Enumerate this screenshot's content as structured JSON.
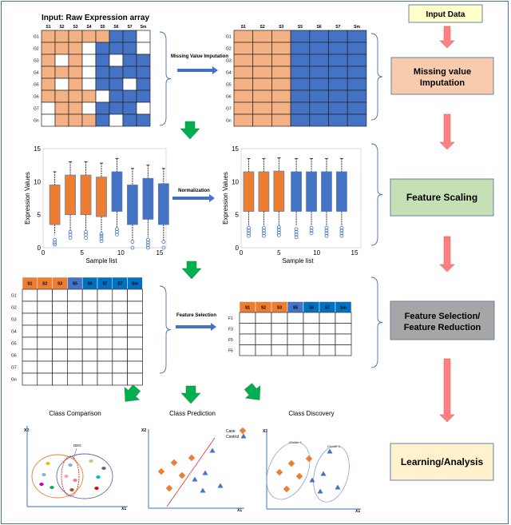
{
  "raw_matrix": {
    "title": "Input: Raw Expression array",
    "columns": [
      "S1",
      "S2",
      "S3",
      "S4",
      "S5",
      "S6",
      "S7",
      "Sm"
    ],
    "rows": [
      "G1",
      "G2",
      "G3",
      "G4",
      "G5",
      "G6",
      "G7",
      "Gn"
    ],
    "cells": [
      "ooooobbwb",
      "ooowbbbw",
      "owowbwbb",
      "ooowbbbb",
      "owowbbwb",
      "oooowbbb",
      "woowbbbw",
      "wooobwbb"
    ]
  },
  "imputation_arrow_label": "Missing Value Imputation",
  "imputed_matrix": {
    "columns": [
      "S1",
      "S2",
      "S3",
      "S5",
      "S6",
      "S7",
      "Sm"
    ],
    "rows": [
      "G1",
      "G2",
      "G3",
      "G4",
      "G5",
      "G6",
      "G7",
      "Gn"
    ],
    "orange_columns": 3
  },
  "normalization_arrow_label": "Normalization",
  "chart_data": [
    {
      "type": "box",
      "xlabel": "Sample list",
      "ylabel": "Expression Values",
      "xlim": [
        0,
        15
      ],
      "ylim": [
        0,
        15
      ],
      "xticks": [
        "0",
        "5",
        "10",
        "15"
      ],
      "yticks": [
        "0",
        "5",
        "10",
        "15"
      ],
      "boxes": [
        {
          "x": 1.5,
          "q1": 3.5,
          "q3": 9.5,
          "hi": 11.5,
          "lo": 2,
          "outliers": [
            0.5,
            0.8,
            1.2
          ],
          "group": "case"
        },
        {
          "x": 3.5,
          "q1": 5,
          "q3": 11,
          "hi": 13,
          "lo": 2.5,
          "outliers": [
            1.5,
            2,
            2.4
          ],
          "group": "case"
        },
        {
          "x": 5.5,
          "q1": 5,
          "q3": 11,
          "hi": 13,
          "lo": 2.5,
          "outliers": [
            1.5,
            2,
            2.4
          ],
          "group": "case"
        },
        {
          "x": 7.5,
          "q1": 4.7,
          "q3": 10.7,
          "hi": 12.8,
          "lo": 2.3,
          "outliers": [
            1,
            1.4,
            1.8,
            2.1
          ],
          "group": "case"
        },
        {
          "x": 9.5,
          "q1": 5.5,
          "q3": 11.5,
          "hi": 13.5,
          "lo": 3,
          "outliers": [
            2,
            2.4,
            2.8
          ],
          "group": "control"
        },
        {
          "x": 11.5,
          "q1": 3.5,
          "q3": 9.5,
          "hi": 12,
          "lo": 1.2,
          "outliers": [
            0,
            0.9
          ],
          "group": "control"
        },
        {
          "x": 13.5,
          "q1": 4.3,
          "q3": 10.5,
          "hi": 12.5,
          "lo": 1.6,
          "outliers": [
            0,
            0.4,
            0.8,
            1.2
          ],
          "group": "control"
        },
        {
          "x": 15.5,
          "q1": 3.5,
          "q3": 9.7,
          "hi": 12,
          "lo": 1.2,
          "outliers": [
            0,
            0.9
          ],
          "group": "control"
        }
      ]
    },
    {
      "type": "box",
      "xlabel": "Sample list",
      "ylabel": "Expression Values",
      "xlim": [
        0,
        15
      ],
      "ylim": [
        0,
        15
      ],
      "xticks": [
        "0",
        "5",
        "10",
        "15"
      ],
      "yticks": [
        "0",
        "5",
        "10",
        "15"
      ],
      "boxes": [
        {
          "x": 1,
          "q1": 5.5,
          "q3": 11.5,
          "hi": 13.5,
          "lo": 3.3,
          "outliers": [
            1.8,
            2.2,
            2.6,
            3
          ]
        },
        {
          "x": 3,
          "q1": 5.5,
          "q3": 11.5,
          "hi": 13.5,
          "lo": 3.3,
          "outliers": [
            1.8,
            2.2,
            2.6,
            3
          ]
        },
        {
          "x": 5,
          "q1": 5.5,
          "q3": 11.6,
          "hi": 13.6,
          "lo": 3.3,
          "outliers": [
            1.9,
            2.3,
            2.7,
            3.1
          ]
        },
        {
          "x": 7.3,
          "q1": 5.5,
          "q3": 11.5,
          "hi": 13.5,
          "lo": 3.3,
          "outliers": [
            1.6,
            2,
            2.4,
            2.8
          ]
        },
        {
          "x": 9.3,
          "q1": 5.5,
          "q3": 11.5,
          "hi": 13.5,
          "lo": 3.3,
          "outliers": [
            2.2,
            2.6,
            3
          ]
        },
        {
          "x": 11.3,
          "q1": 5.5,
          "q3": 11.5,
          "hi": 13.5,
          "lo": 3.3,
          "outliers": [
            1.8,
            2.2,
            2.6,
            3
          ]
        },
        {
          "x": 13.3,
          "q1": 5.5,
          "q3": 11.5,
          "hi": 13.5,
          "lo": 3.3,
          "outliers": [
            1.8,
            2.2,
            2.6,
            3
          ]
        }
      ],
      "box_groups": [
        "case",
        "case",
        "case",
        "control",
        "control",
        "control",
        "control"
      ]
    }
  ],
  "feature_matrix": {
    "columns": [
      "S1",
      "S2",
      "S3",
      "S5",
      "S6",
      "S7",
      "S7",
      "Sm"
    ],
    "rows": [
      "G1",
      "G2",
      "G3",
      "G4",
      "G5",
      "G6",
      "G7",
      "Gn"
    ]
  },
  "feature_selection_arrow_label": "Feature Selection",
  "selected_matrix": {
    "columns": [
      "S1",
      "S2",
      "S3",
      "S5",
      "S6",
      "S7",
      "Sm"
    ],
    "rows": [
      "F1",
      "F3",
      "F5",
      "F6"
    ]
  },
  "analysis": {
    "comparison": {
      "title": "Class Comparison",
      "x": "X1",
      "y": "X2",
      "label": "DEG"
    },
    "prediction": {
      "title": "Class Prediction",
      "x": "X1",
      "y": "X2",
      "legend_case": "Case",
      "legend_control": "Control"
    },
    "discovery": {
      "title": "Class Discovery",
      "x": "X1",
      "y": "X2",
      "cluster1": "Cluster 1",
      "cluster2": "Cluster 2"
    }
  },
  "pipeline": [
    {
      "label": "Input Data",
      "color": "#ffffcc"
    },
    {
      "label": "Missing value",
      "label2": "Imputation",
      "color": "#f8cbad"
    },
    {
      "label": "Feature Scaling",
      "color": "#c5e0b4"
    },
    {
      "label": "Feature Selection/",
      "label2": "Feature Reduction",
      "color": "#a6a6a6"
    },
    {
      "label": "Learning/Analysis",
      "color": "#fff2cc"
    }
  ],
  "colors": {
    "orange": "#f4b183",
    "orange_dark": "#ed7d31",
    "blue": "#4472c4",
    "green": "#00b050",
    "pink": "#ff8080",
    "brace": "#4a6fa5"
  }
}
